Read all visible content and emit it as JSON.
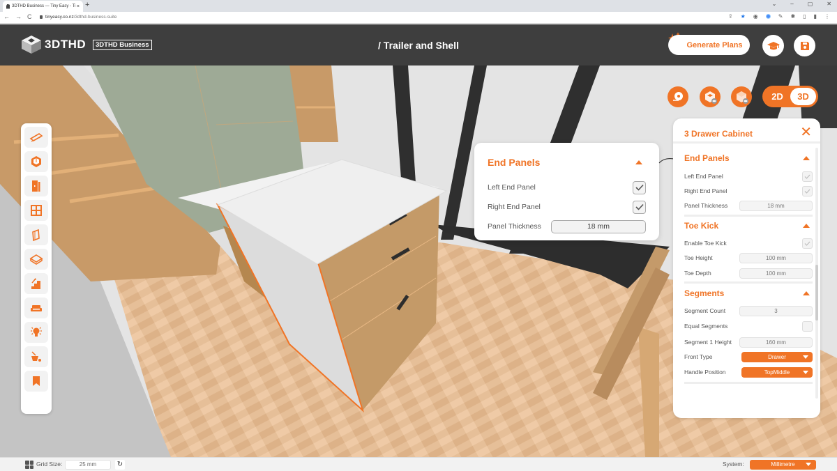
{
  "browser": {
    "tab_title": "3DTHD Business — Tiny Easy - Ti",
    "tab_close": "×",
    "new_tab": "+",
    "url_domain": "tinyeasy.co.nz",
    "url_path": "/3dthd-business-suite",
    "window_controls": [
      "⌄",
      "–",
      "▢",
      "✕"
    ],
    "nav": [
      "←",
      "→",
      "C"
    ]
  },
  "header": {
    "logo_text": "3DTHD",
    "badge": "3DTHD Business",
    "breadcrumb": "/ Trailer and Shell",
    "generate_label": "Generate Plans"
  },
  "toolbar": {
    "items": [
      {
        "name": "floor-plan"
      },
      {
        "name": "walls"
      },
      {
        "name": "doors"
      },
      {
        "name": "windows"
      },
      {
        "name": "panels"
      },
      {
        "name": "floor"
      },
      {
        "name": "stairs"
      },
      {
        "name": "furniture"
      },
      {
        "name": "lighting"
      },
      {
        "name": "paint"
      },
      {
        "name": "bookmark"
      }
    ]
  },
  "view": {
    "mode_2d": "2D",
    "mode_3d": "3D",
    "active": "3D"
  },
  "popup": {
    "title": "End Panels",
    "left_end_panel": {
      "label": "Left End Panel",
      "checked": true
    },
    "right_end_panel": {
      "label": "Right End Panel",
      "checked": true
    },
    "panel_thickness": {
      "label": "Panel Thickness",
      "value": "18 mm"
    }
  },
  "panel": {
    "title": "3 Drawer Cabinet",
    "close": "✕",
    "end_panels": {
      "title": "End Panels",
      "left_end_panel": {
        "label": "Left End Panel",
        "checked": true
      },
      "right_end_panel": {
        "label": "Right End Panel",
        "checked": true
      },
      "panel_thickness": {
        "label": "Panel Thickness",
        "value": "18 mm"
      }
    },
    "toe_kick": {
      "title": "Toe Kick",
      "enable": {
        "label": "Enable Toe Kick",
        "checked": true
      },
      "height": {
        "label": "Toe Height",
        "value": "100 mm"
      },
      "depth": {
        "label": "Toe Depth",
        "value": "100 mm"
      }
    },
    "segments": {
      "title": "Segments",
      "count": {
        "label": "Segment Count",
        "value": "3"
      },
      "equal": {
        "label": "Equal Segments",
        "checked": false
      },
      "seg1_height": {
        "label": "Segment 1 Height",
        "value": "160 mm"
      },
      "front_type": {
        "label": "Front Type",
        "value": "Drawer"
      },
      "handle_position": {
        "label": "Handle Position",
        "value": "TopMiddle"
      }
    }
  },
  "footer": {
    "grid_label": "Grid Size:",
    "grid_value": "25 mm",
    "reset": "↻",
    "system_label": "System:",
    "system_value": "Millimetre"
  },
  "colors": {
    "accent": "#f07426",
    "header_bg": "#3e3e3e"
  }
}
